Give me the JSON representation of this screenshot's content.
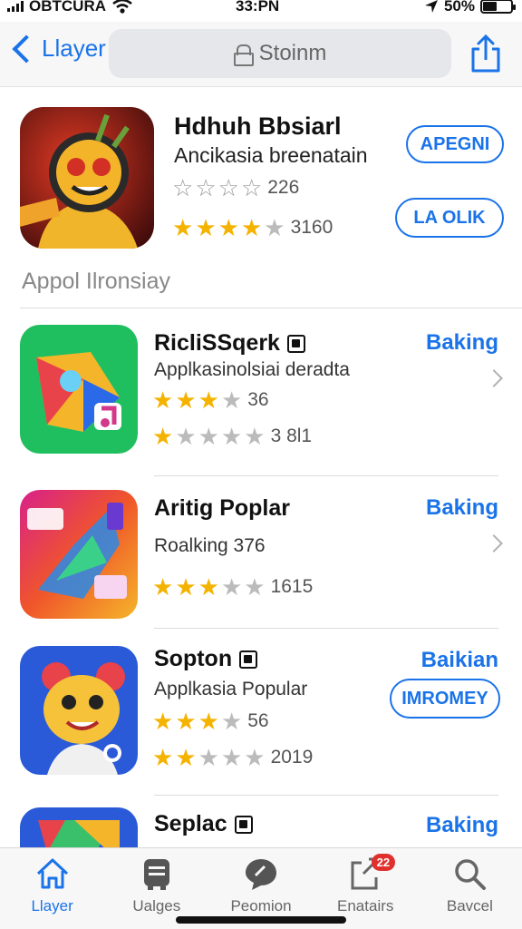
{
  "status_bar": {
    "carrier": "OBTCURA",
    "time": "33:PN",
    "battery": "50%",
    "battery_level": 0.5
  },
  "nav": {
    "back_label": "Llayer",
    "search_text": "Stoinm"
  },
  "featured": {
    "title": "Hdhuh Bbsiarl",
    "subtitle": "Ancikasia breenatain",
    "rating_count_1": "226",
    "rating_count_2": "3160",
    "button_1": "APEGNI",
    "button_2": "LA OLIK",
    "stars_1": 0,
    "stars_2": 4
  },
  "section_title": "Appol Ilronsiay",
  "apps": [
    {
      "name": "RicliSSqerk",
      "subtitle": "Applkasinolsiai deradta",
      "action": "Baking",
      "count_1": "36",
      "count_2": "3 8l1",
      "stars_1": 3,
      "stars_2": 1,
      "has_badge": true
    },
    {
      "name": "Aritig Poplar",
      "subtitle": "Roalking 376",
      "action": "Baking",
      "count_1": "1615",
      "stars_1": 3,
      "has_badge": false
    },
    {
      "name": "Sopton",
      "subtitle": "Applkasia Popular",
      "action": "Baikian",
      "button": "IMROMEY",
      "count_1": "56",
      "count_2": "2019",
      "stars_1": 3,
      "stars_2": 2,
      "has_badge": true
    },
    {
      "name": "Seplac",
      "action": "Baking",
      "has_badge": true
    }
  ],
  "tabs": [
    {
      "label": "Llayer",
      "icon": "home-icon"
    },
    {
      "label": "Ualges",
      "icon": "games-icon"
    },
    {
      "label": "Peomion",
      "icon": "chat-icon"
    },
    {
      "label": "Enatairs",
      "icon": "updates-icon",
      "badge": "22"
    },
    {
      "label": "Bavcel",
      "icon": "search-icon"
    }
  ],
  "colors": {
    "accent": "#1a73e8",
    "star": "#f5b301",
    "badge": "#e0302e"
  }
}
